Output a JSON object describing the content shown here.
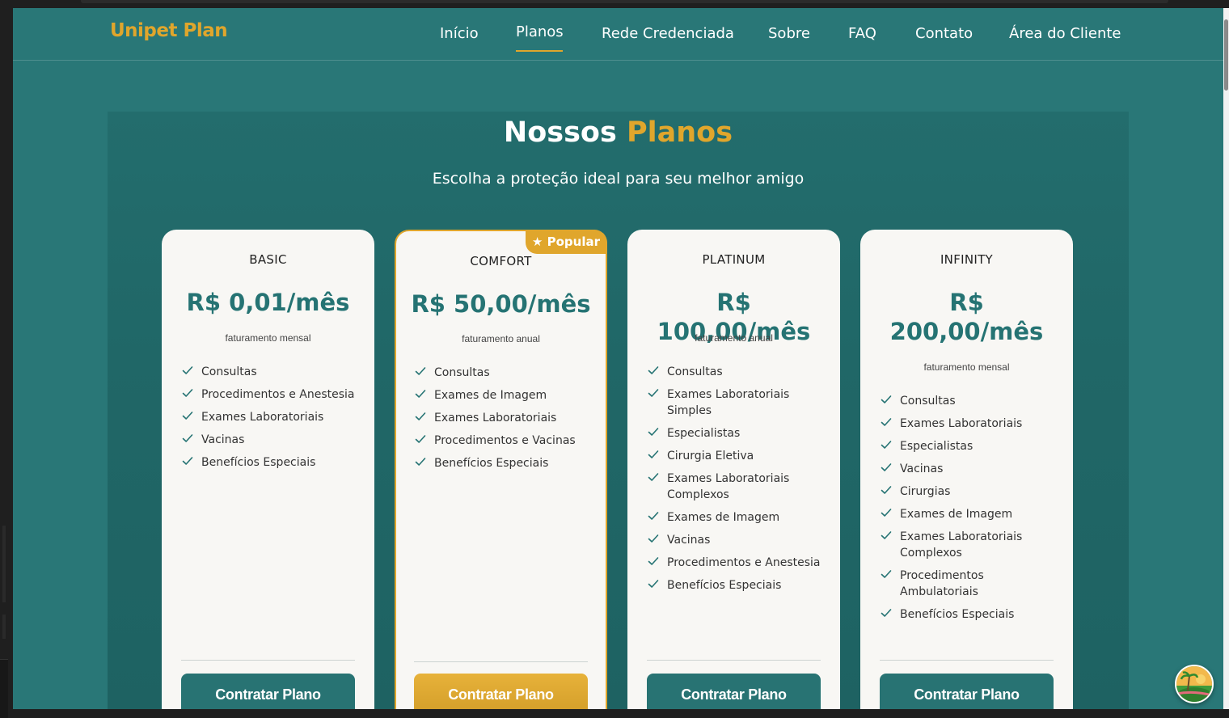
{
  "nav": {
    "logo": "Unipet Plan",
    "links": [
      {
        "label": "Início"
      },
      {
        "label": "Planos"
      },
      {
        "label": "Rede Credenciada"
      },
      {
        "label": "Sobre"
      },
      {
        "label": "FAQ"
      },
      {
        "label": "Contato"
      },
      {
        "label": "Área do Cliente"
      }
    ],
    "active": "Planos"
  },
  "hero": {
    "title_part1": "Nossos",
    "title_part2": "Planos",
    "subtitle": "Escolha a proteção ideal para seu melhor amigo"
  },
  "plans": [
    {
      "name": "BASIC",
      "price": "R$ 0,01/mês",
      "billing": "faturamento mensal",
      "features": [
        "Consultas",
        "Procedimentos e Anestesia",
        "Exames Laboratoriais",
        "Vacinas",
        "Benefícios Especiais"
      ],
      "cta": "Contratar Plano"
    },
    {
      "name": "COMFORT",
      "badge": "Popular",
      "price": "R$ 50,00/mês",
      "billing": "faturamento anual",
      "features": [
        "Consultas",
        "Exames de Imagem",
        "Exames Laboratoriais",
        "Procedimentos e Vacinas",
        "Benefícios Especiais"
      ],
      "cta": "Contratar Plano"
    },
    {
      "name": "PLATINUM",
      "price": "R$ 100,00/mês",
      "billing": "faturamento anual",
      "features": [
        "Consultas",
        "Exames Laboratoriais Simples",
        "Especialistas",
        "Cirurgia Eletiva",
        "Exames Laboratoriais Complexos",
        "Exames de Imagem",
        "Vacinas",
        "Procedimentos e Anestesia",
        "Benefícios Especiais"
      ],
      "cta": "Contratar Plano"
    },
    {
      "name": "INFINITY",
      "price": "R$ 200,00/mês",
      "billing": "faturamento mensal",
      "features": [
        "Consultas",
        "Exames Laboratoriais",
        "Especialistas",
        "Vacinas",
        "Cirurgias",
        "Exames de Imagem",
        "Exames Laboratoriais Complexos",
        "Procedimentos Ambulatoriais",
        "Benefícios Especiais"
      ],
      "cta": "Contratar Plano"
    }
  ],
  "colors": {
    "background": "#297777",
    "accent": "#e0a62c",
    "card": "#f8f7f4",
    "price": "#257373",
    "button": "#287373"
  }
}
